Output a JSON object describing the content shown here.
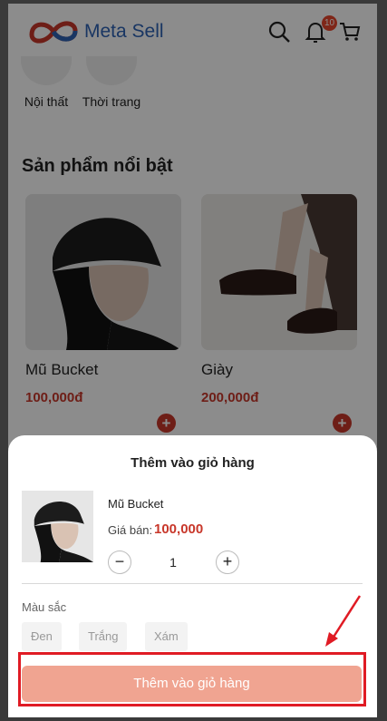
{
  "header": {
    "brand": "Meta Sell",
    "cart_badge": "10",
    "icons": [
      "search-icon",
      "bell-icon",
      "cart-icon"
    ]
  },
  "categories": [
    {
      "label": "Nội thất"
    },
    {
      "label": "Thời trang"
    }
  ],
  "featured": {
    "title": "Sản phẩm nổi bật",
    "products": [
      {
        "name": "Mũ Bucket",
        "price": "100,000đ"
      },
      {
        "name": "Giày",
        "price": "200,000đ"
      }
    ]
  },
  "sheet": {
    "title": "Thêm vào giỏ hàng",
    "product_name": "Mũ Bucket",
    "price_label": "Giá bán:",
    "price": "100,000",
    "quantity": "1",
    "minus": "−",
    "plus": "+",
    "color_label": "Màu sắc",
    "colors": [
      "Đen",
      "Trắng",
      "Xám"
    ],
    "submit_label": "Thêm vào giỏ hàng"
  },
  "colors": {
    "accent": "#c8372a",
    "brand_blue": "#2f63b5",
    "submit_disabled": "#f0a491",
    "highlight": "#e01b24"
  }
}
